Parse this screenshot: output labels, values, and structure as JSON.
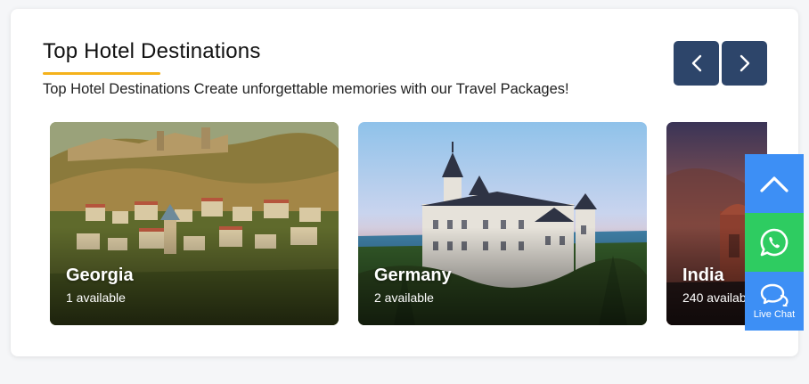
{
  "section": {
    "title": "Top Hotel Destinations",
    "subtitle": "Top Hotel Destinations Create unforgettable memories with our Travel Packages!"
  },
  "nav": {
    "prev_icon": "chevron-left-icon",
    "next_icon": "chevron-right-icon"
  },
  "destinations": [
    {
      "name": "Georgia",
      "availability": "1 available"
    },
    {
      "name": "Germany",
      "availability": "2 available"
    },
    {
      "name": "India",
      "availability": "240 available"
    }
  ],
  "floating": {
    "scroll_top_icon": "chevron-up-icon",
    "whatsapp_icon": "whatsapp-icon",
    "chat_icon": "chat-bubbles-icon",
    "chat_label": "Live Chat"
  },
  "colors": {
    "accent_underline": "#f5b21b",
    "nav_button": "#2d456a",
    "scroll_top": "#3d8ff5",
    "whatsapp": "#2ecc61",
    "live_chat": "#3d8ff5"
  }
}
